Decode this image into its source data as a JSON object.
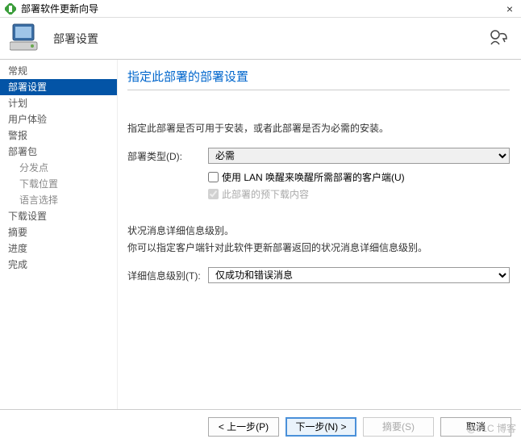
{
  "window": {
    "title": "部署软件更新向导"
  },
  "banner": {
    "title": "部署设置"
  },
  "sidebar": {
    "items": [
      {
        "label": "常规",
        "sub": false
      },
      {
        "label": "部署设置",
        "sub": false,
        "active": true
      },
      {
        "label": "计划",
        "sub": false
      },
      {
        "label": "用户体验",
        "sub": false
      },
      {
        "label": "警报",
        "sub": false
      },
      {
        "label": "部署包",
        "sub": false
      },
      {
        "label": "分发点",
        "sub": true
      },
      {
        "label": "下载位置",
        "sub": true
      },
      {
        "label": "语言选择",
        "sub": true
      },
      {
        "label": "下载设置",
        "sub": false
      },
      {
        "label": "摘要",
        "sub": false
      },
      {
        "label": "进度",
        "sub": false
      },
      {
        "label": "完成",
        "sub": false
      }
    ]
  },
  "content": {
    "heading": "指定此部署的部署设置",
    "para1": "指定此部署是否可用于安装，或者此部署是否为必需的安装。",
    "typeLabel": "部署类型(D):",
    "typeValue": "必需",
    "cb1": "使用 LAN 唤醒来唤醒所需部署的客户端(U)",
    "cb2": "此部署的预下载内容",
    "para2a": "状况消息详细信息级别。",
    "para2b": "你可以指定客户端针对此软件更新部署返回的状况消息详细信息级别。",
    "detailLabel": "详细信息级别(T):",
    "detailValue": "仅成功和错误消息"
  },
  "footer": {
    "prev": "< 上一步(P)",
    "next": "下一步(N) >",
    "summary": "摘要(S)",
    "cancel": "取消"
  },
  "watermark": "@51C     博客"
}
